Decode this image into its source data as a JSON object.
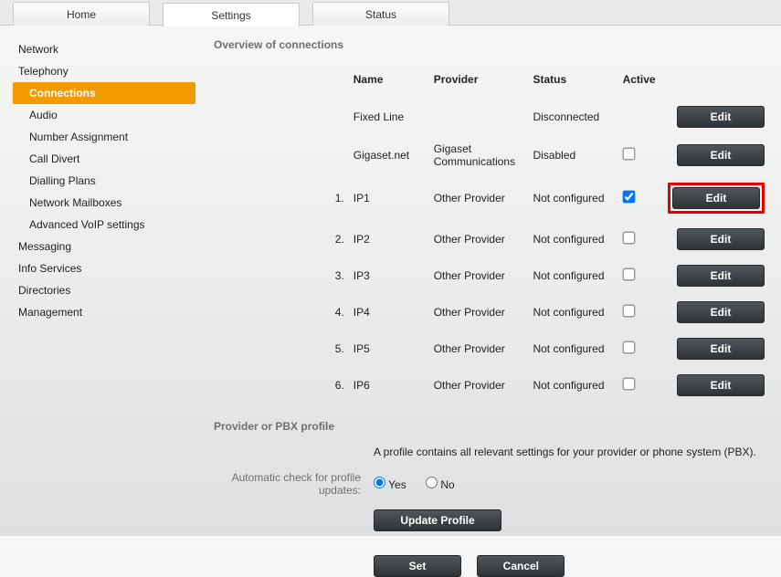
{
  "tabs": {
    "home": "Home",
    "settings": "Settings",
    "status": "Status"
  },
  "sidebar": {
    "network": "Network",
    "telephony": "Telephony",
    "telephony_items": {
      "connections": "Connections",
      "audio": "Audio",
      "number_assignment": "Number Assignment",
      "call_divert": "Call Divert",
      "dialling_plans": "Dialling Plans",
      "network_mailboxes": "Network Mailboxes",
      "advanced_voip": "Advanced VoIP settings"
    },
    "messaging": "Messaging",
    "info_services": "Info Services",
    "directories": "Directories",
    "management": "Management"
  },
  "section": {
    "title": "Overview of connections",
    "headers": {
      "name": "Name",
      "provider": "Provider",
      "status": "Status",
      "active": "Active"
    },
    "rows": [
      {
        "num": "",
        "name": "Fixed Line",
        "provider": "",
        "status": "Disconnected",
        "checkbox": false,
        "checked": false,
        "highlight": false
      },
      {
        "num": "",
        "name": "Gigaset.net",
        "provider": "Gigaset Communications",
        "status": "Disabled",
        "checkbox": true,
        "checked": false,
        "highlight": false
      },
      {
        "num": "1.",
        "name": "IP1",
        "provider": "Other Provider",
        "status": "Not configured",
        "checkbox": true,
        "checked": true,
        "highlight": true
      },
      {
        "num": "2.",
        "name": "IP2",
        "provider": "Other Provider",
        "status": "Not configured",
        "checkbox": true,
        "checked": false,
        "highlight": false
      },
      {
        "num": "3.",
        "name": "IP3",
        "provider": "Other Provider",
        "status": "Not configured",
        "checkbox": true,
        "checked": false,
        "highlight": false
      },
      {
        "num": "4.",
        "name": "IP4",
        "provider": "Other Provider",
        "status": "Not configured",
        "checkbox": true,
        "checked": false,
        "highlight": false
      },
      {
        "num": "5.",
        "name": "IP5",
        "provider": "Other Provider",
        "status": "Not configured",
        "checkbox": true,
        "checked": false,
        "highlight": false
      },
      {
        "num": "6.",
        "name": "IP6",
        "provider": "Other Provider",
        "status": "Not configured",
        "checkbox": true,
        "checked": false,
        "highlight": false
      }
    ],
    "edit_label": "Edit"
  },
  "profile": {
    "title": "Provider or PBX profile",
    "help": "A profile contains all relevant settings for your provider or phone system (PBX).",
    "auto_label": "Automatic check for profile updates:",
    "yes": "Yes",
    "no": "No",
    "update_btn": "Update Profile",
    "set_btn": "Set",
    "cancel_btn": "Cancel"
  }
}
